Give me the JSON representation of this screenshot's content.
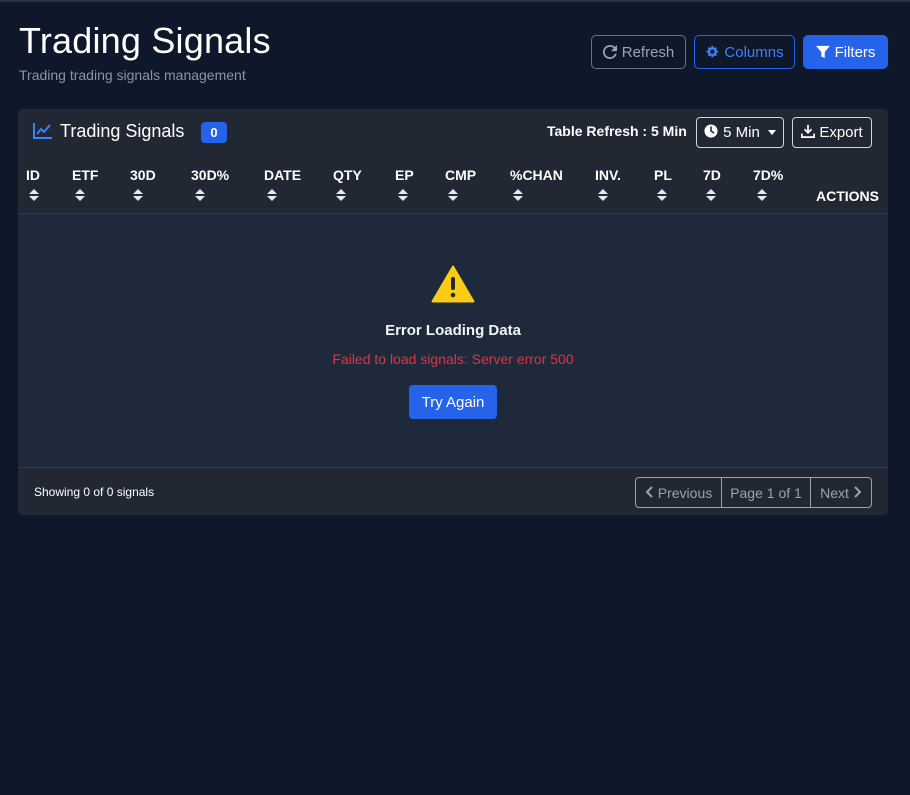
{
  "header": {
    "title": "Trading Signals",
    "subtitle": "Trading trading signals management"
  },
  "toolbar": {
    "refresh_label": "Refresh",
    "columns_label": "Columns",
    "filters_label": "Filters"
  },
  "card": {
    "title": "Trading Signals",
    "count": "0",
    "refresh_info": "Table Refresh : 5 Min",
    "interval_label": "5 Min",
    "export_label": "Export"
  },
  "table": {
    "columns": [
      "ID",
      "ETF",
      "30D",
      "30D%",
      "DATE",
      "QTY",
      "EP",
      "CMP",
      "%CHAN",
      "INV.",
      "PL",
      "7D",
      "7D%"
    ],
    "actions_label": "ACTIONS"
  },
  "error": {
    "title": "Error Loading Data",
    "message": "Failed to load signals: Server error 500",
    "retry_label": "Try Again"
  },
  "footer": {
    "showing": "Showing 0 of 0 signals",
    "prev_label": "Previous",
    "page_label": "Page 1 of 1",
    "next_label": "Next"
  },
  "colors": {
    "background": "#0f172a",
    "card": "#1e293b",
    "primary": "#2563eb",
    "error": "#dc3545",
    "warning": "#facc15"
  }
}
